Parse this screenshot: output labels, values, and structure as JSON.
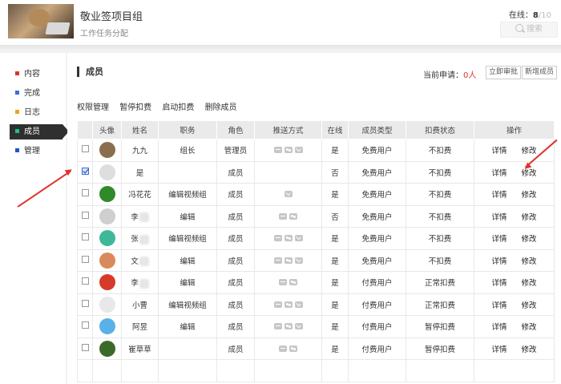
{
  "header": {
    "title": "敬业签项目组",
    "subtitle": "工作任务分配",
    "online_label": "在线：",
    "online_count": "8",
    "online_sep": "/",
    "online_total": "10",
    "search_label": "搜索"
  },
  "sidebar": {
    "items": [
      {
        "label": "内容",
        "color": "#e0312b"
      },
      {
        "label": "完成",
        "color": "#3b6fd6"
      },
      {
        "label": "日志",
        "color": "#f0a020"
      },
      {
        "label": "成员",
        "color": "#19c48a"
      },
      {
        "label": "管理",
        "color": "#2452c8"
      }
    ],
    "active_index": 3
  },
  "section": {
    "title": "成员",
    "applying_label": "当前申请：",
    "applying_count": "0人",
    "approve_button": "立即审批",
    "add_member_button": "新增成员"
  },
  "actions": [
    "权限管理",
    "暂停扣费",
    "启动扣费",
    "删除成员"
  ],
  "table": {
    "headers": [
      "头像",
      "姓名",
      "职务",
      "角色",
      "推送方式",
      "在线",
      "成员类型",
      "扣费状态",
      "操作"
    ],
    "op_detail": "详情",
    "op_edit": "修改",
    "rows": [
      {
        "checked": false,
        "avatar_color": "#8a6e4e",
        "name": "九九",
        "name_blurred": false,
        "position": "组长",
        "role": "管理员",
        "push": [
          "msg",
          "wx",
          "mail"
        ],
        "online": "是",
        "type": "免费用户",
        "billing": "不扣费"
      },
      {
        "checked": true,
        "avatar_color": "#dedede",
        "name": "是",
        "name_blurred": false,
        "position": "",
        "role": "成员",
        "push": [],
        "online": "否",
        "type": "免费用户",
        "billing": "不扣费"
      },
      {
        "checked": false,
        "avatar_color": "#2f8a2a",
        "name": "冯花花",
        "name_blurred": false,
        "position": "编辑视频组",
        "role": "成员",
        "push": [
          "mail"
        ],
        "online": "是",
        "type": "免费用户",
        "billing": "不扣费"
      },
      {
        "checked": false,
        "avatar_color": "#cfcfcf",
        "name": "李",
        "name_blurred": true,
        "position": "编辑",
        "role": "成员",
        "push": [
          "msg",
          "wx"
        ],
        "online": "否",
        "type": "免费用户",
        "billing": "不扣费"
      },
      {
        "checked": false,
        "avatar_color": "#3fb89a",
        "name": "张",
        "name_blurred": true,
        "position": "编辑视频组",
        "role": "成员",
        "push": [
          "msg",
          "wx",
          "mail"
        ],
        "online": "是",
        "type": "免费用户",
        "billing": "不扣费"
      },
      {
        "checked": false,
        "avatar_color": "#d98a5a",
        "name": "文",
        "name_blurred": true,
        "position": "编辑",
        "role": "成员",
        "push": [
          "msg",
          "wx",
          "mail"
        ],
        "online": "是",
        "type": "免费用户",
        "billing": "不扣费"
      },
      {
        "checked": false,
        "avatar_color": "#d63a2a",
        "name": "李",
        "name_blurred": true,
        "position": "编辑",
        "role": "成员",
        "push": [
          "msg",
          "wx"
        ],
        "online": "是",
        "type": "付费用户",
        "billing": "正常扣费"
      },
      {
        "checked": false,
        "avatar_color": "#e8e8e8",
        "name": "小曹",
        "name_blurred": false,
        "position": "编辑视频组",
        "role": "成员",
        "push": [
          "msg",
          "wx",
          "mail"
        ],
        "online": "是",
        "type": "付费用户",
        "billing": "正常扣费"
      },
      {
        "checked": false,
        "avatar_color": "#5ab0e8",
        "name": "阿昱",
        "name_blurred": false,
        "position": "编辑",
        "role": "成员",
        "push": [
          "msg",
          "wx",
          "mail"
        ],
        "online": "是",
        "type": "付费用户",
        "billing": "暂停扣费"
      },
      {
        "checked": false,
        "avatar_color": "#3a6a2a",
        "name": "崔草草",
        "name_blurred": false,
        "position": "",
        "role": "成员",
        "push": [
          "msg",
          "wx"
        ],
        "online": "是",
        "type": "付费用户",
        "billing": "暂停扣费"
      }
    ]
  },
  "colors": {
    "accent_red": "#e0312b",
    "sidebar_active_bg": "#2f2f2f"
  }
}
